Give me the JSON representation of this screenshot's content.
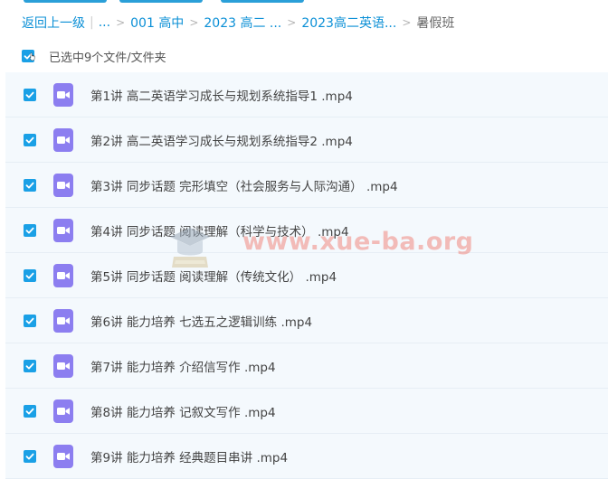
{
  "breadcrumb": {
    "back": "返回上一级",
    "ellipsis": "...",
    "items": [
      "001 高中",
      "2023 高二 ...",
      "2023高二英语..."
    ],
    "current": "暑假班"
  },
  "selection": {
    "text": "已选中9个文件/文件夹"
  },
  "files": [
    "第1讲 高二英语学习成长与规划系统指导1 .mp4",
    "第2讲 高二英语学习成长与规划系统指导2 .mp4",
    "第3讲 同步话题 完形填空（社会服务与人际沟通） .mp4",
    "第4讲 同步话题 阅读理解（科学与技术） .mp4",
    "第5讲 同步话题 阅读理解（传统文化） .mp4",
    "第6讲 能力培养 七选五之逻辑训练 .mp4",
    "第7讲 能力培养 介绍信写作 .mp4",
    "第8讲 能力培养 记叙文写作 .mp4",
    "第9讲 能力培养 经典题目串讲 .mp4"
  ],
  "watermark": "www.xue-ba.org",
  "colors": {
    "accent": "#1aa0e6",
    "link": "#0a8fd6",
    "video_icon": "#8c7ef0",
    "row_bg": "#f4f9fd"
  },
  "icons": {
    "checkbox": "check-icon",
    "file": "video-file-icon",
    "cursor": "hand-cursor-icon"
  }
}
